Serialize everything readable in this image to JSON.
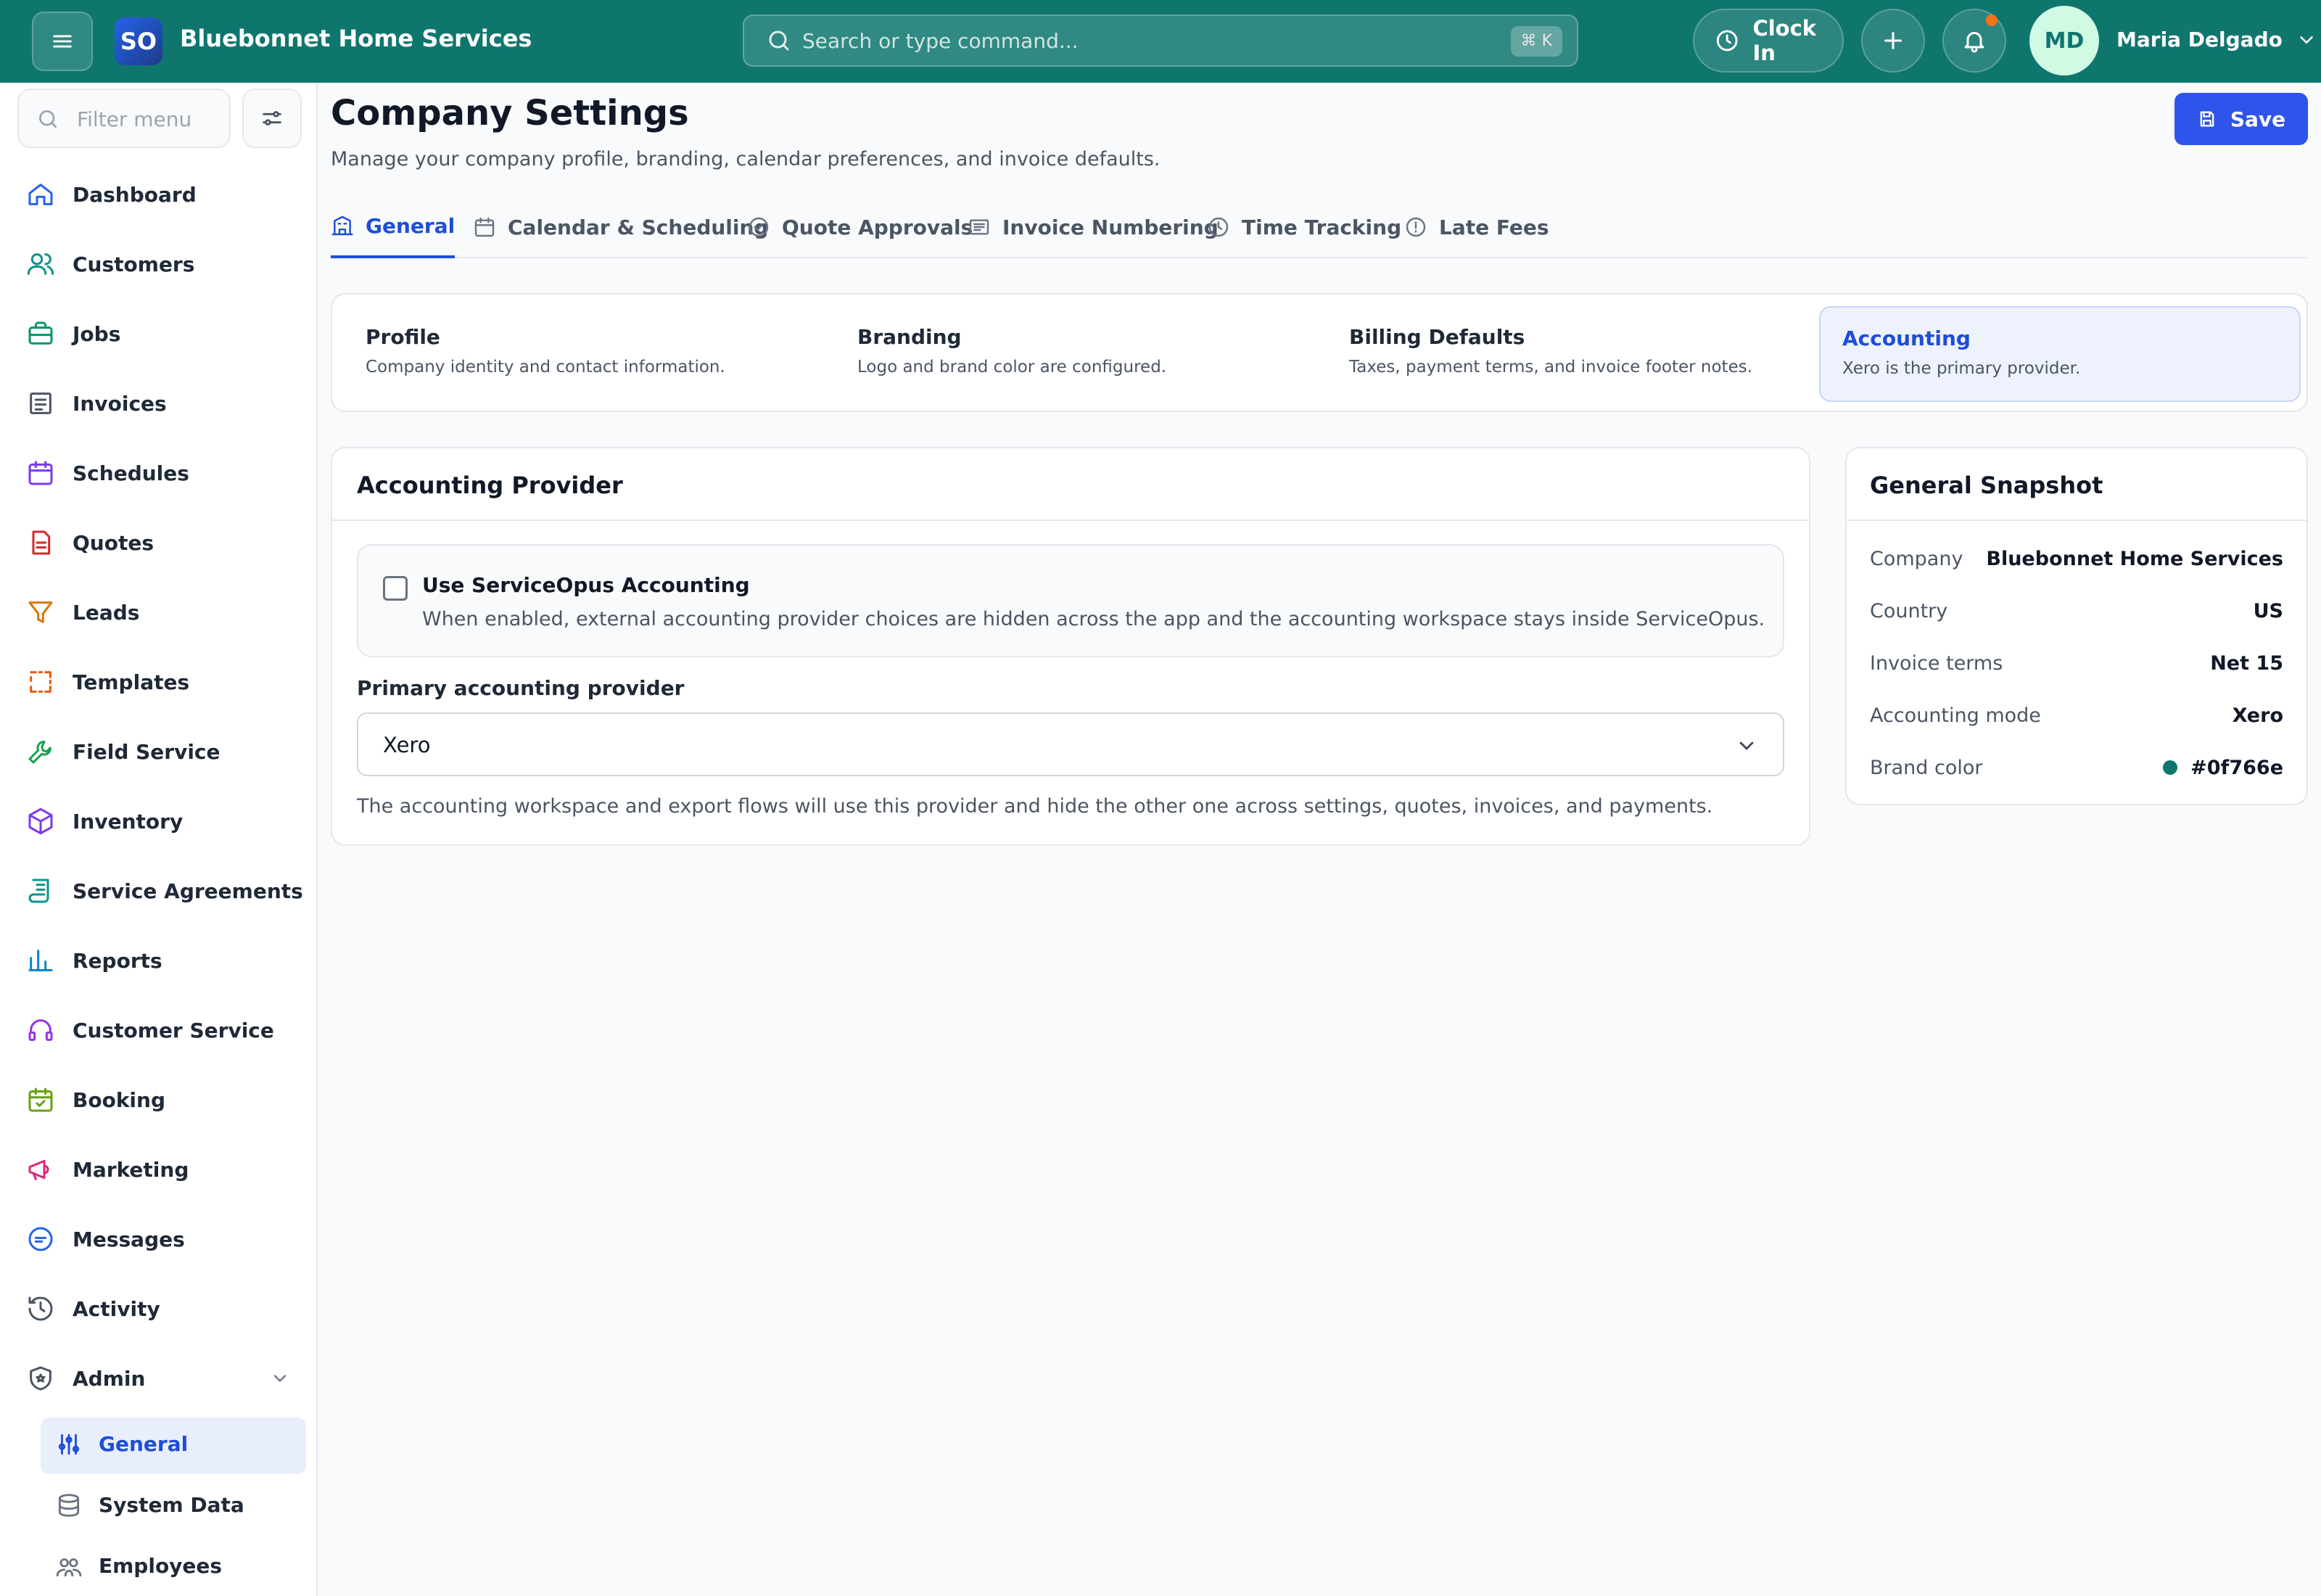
{
  "topbar": {
    "logo_text": "SO",
    "company_name": "Bluebonnet Home Services",
    "search_placeholder": "Search or type command...",
    "search_shortcut": "⌘ K",
    "clock_in_label": "Clock In",
    "user_initials": "MD",
    "user_name": "Maria Delgado"
  },
  "sidebar": {
    "filter_placeholder": "Filter menu",
    "items": [
      {
        "label": "Dashboard",
        "icon": "home-icon",
        "color": "#2563eb"
      },
      {
        "label": "Customers",
        "icon": "users-icon",
        "color": "#0d9488"
      },
      {
        "label": "Jobs",
        "icon": "briefcase-icon",
        "color": "#059669"
      },
      {
        "label": "Invoices",
        "icon": "invoice-icon",
        "color": "#4b5563"
      },
      {
        "label": "Schedules",
        "icon": "calendar-icon",
        "color": "#7c3aed"
      },
      {
        "label": "Quotes",
        "icon": "file-icon",
        "color": "#dc2626"
      },
      {
        "label": "Leads",
        "icon": "funnel-icon",
        "color": "#d97706"
      },
      {
        "label": "Templates",
        "icon": "template-icon",
        "color": "#ea580c"
      },
      {
        "label": "Field Service",
        "icon": "wrench-icon",
        "color": "#16a34a"
      },
      {
        "label": "Inventory",
        "icon": "box-icon",
        "color": "#7c3aed"
      },
      {
        "label": "Service Agreements",
        "icon": "scroll-icon",
        "color": "#0d9488"
      },
      {
        "label": "Reports",
        "icon": "bar-chart-icon",
        "color": "#0284c7"
      },
      {
        "label": "Customer Service",
        "icon": "headset-icon",
        "color": "#9333ea"
      },
      {
        "label": "Booking",
        "icon": "calendar-check-icon",
        "color": "#65a30d"
      },
      {
        "label": "Marketing",
        "icon": "megaphone-icon",
        "color": "#db2777"
      },
      {
        "label": "Messages",
        "icon": "chat-icon",
        "color": "#2563eb"
      },
      {
        "label": "Activity",
        "icon": "history-icon",
        "color": "#4b5563"
      },
      {
        "label": "Admin",
        "icon": "shield-icon",
        "color": "#4b5563"
      }
    ],
    "admin_subitems": [
      {
        "label": "General",
        "icon": "sliders-icon",
        "active": true
      },
      {
        "label": "System Data",
        "icon": "database-icon",
        "active": false
      },
      {
        "label": "Employees",
        "icon": "people-icon",
        "active": false
      }
    ]
  },
  "page": {
    "title": "Company Settings",
    "description": "Manage your company profile, branding, calendar preferences, and invoice defaults.",
    "save_label": "Save"
  },
  "tabs": [
    {
      "label": "General",
      "icon": "building-icon",
      "active": true
    },
    {
      "label": "Calendar & Scheduling",
      "icon": "calendar-icon",
      "active": false
    },
    {
      "label": "Quote Approvals",
      "icon": "check-circle-icon",
      "active": false
    },
    {
      "label": "Invoice Numbering",
      "icon": "list-icon",
      "active": false
    },
    {
      "label": "Time Tracking",
      "icon": "clock-icon",
      "active": false
    },
    {
      "label": "Late Fees",
      "icon": "alert-circle-icon",
      "active": false
    }
  ],
  "sections": [
    {
      "title": "Profile",
      "desc": "Company identity and contact information.",
      "active": false
    },
    {
      "title": "Branding",
      "desc": "Logo and brand color are configured.",
      "active": false
    },
    {
      "title": "Billing Defaults",
      "desc": "Taxes, payment terms, and invoice footer notes.",
      "active": false
    },
    {
      "title": "Accounting",
      "desc": "Xero is the primary provider.",
      "active": true
    }
  ],
  "accounting": {
    "title": "Accounting Provider",
    "toggle_label": "Use ServiceOpus Accounting",
    "toggle_checked": false,
    "toggle_help": "When enabled, external accounting provider choices are hidden across the app and the accounting workspace stays inside ServiceOpus.",
    "provider_label": "Primary accounting provider",
    "provider_value": "Xero",
    "provider_help": "The accounting workspace and export flows will use this provider and hide the other one across settings, quotes, invoices, and payments."
  },
  "snapshot": {
    "title": "General Snapshot",
    "rows": [
      {
        "key": "Company",
        "value": "Bluebonnet Home Services"
      },
      {
        "key": "Country",
        "value": "US"
      },
      {
        "key": "Invoice terms",
        "value": "Net 15"
      },
      {
        "key": "Accounting mode",
        "value": "Xero"
      },
      {
        "key": "Brand color",
        "value": "#0f766e"
      }
    ],
    "brand_color": "#0f766e"
  }
}
